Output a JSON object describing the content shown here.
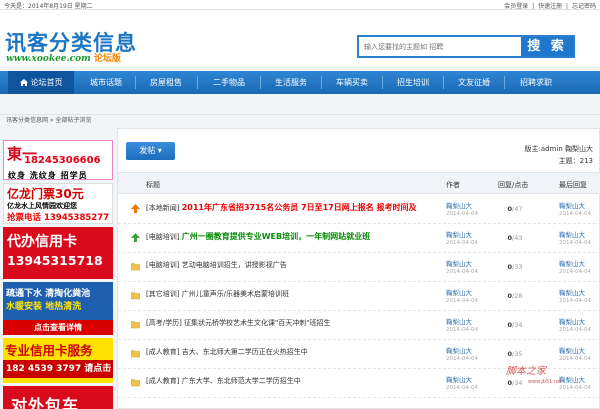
{
  "topbar": {
    "date": "今天是：2014年8月19日 星期二",
    "links": [
      "会员登录",
      "|",
      "快速注册",
      "|",
      "忘记密码"
    ]
  },
  "header": {
    "logo_main": "讯客分类信息",
    "logo_url": "www.xookee.com",
    "logo_badge": "论坛版",
    "search_placeholder": "输入您要找的主题如 招聘",
    "search_button": "搜 索"
  },
  "nav": {
    "items": [
      {
        "label": "论坛首页",
        "active": true
      },
      {
        "label": "城市话题"
      },
      {
        "label": "房屋租售"
      },
      {
        "label": "二手物品"
      },
      {
        "label": "生活服务"
      },
      {
        "label": "车辆买卖"
      },
      {
        "label": "招生培训"
      },
      {
        "label": "文友征婚"
      },
      {
        "label": "招聘求职"
      }
    ]
  },
  "breadcrumb": "讯客分类信息网 » 全部帖子浏览",
  "ads": {
    "ad1": {
      "big": "東一",
      "phone": "18245306606",
      "sub": "纹身 洗纹身 招学员"
    },
    "ad2": {
      "l1": "亿龙门票30元",
      "l2": "亿龙水上风情园欢迎您",
      "l3": "抢票电话 13945385277"
    },
    "ad3": {
      "l1": "代办信用卡",
      "l2": "13945315718"
    },
    "ad4": {
      "l1": "疏通下水 清掏化粪池",
      "l2": "水暖安装 地热清洗",
      "l3": "点击查看详情"
    },
    "ad5": {
      "l1": "专业信用卡服务",
      "l2": "182 4539 3797 请点击"
    },
    "ad6": {
      "l1": "对外包车"
    }
  },
  "main": {
    "post_button": "发帖",
    "moderator": "版主:admin 鞠梨山大",
    "topic_count": "主题：213",
    "headers": {
      "title": "标题",
      "author": "作者",
      "reply": "回复/点击",
      "last": "最后回复"
    },
    "rows": [
      {
        "icon": "hot",
        "tag": "[本地新闻]",
        "title": "2011年广东省招3715名公务员 7日至17日网上报名 报考时间及",
        "style": "hot",
        "author": "鞠梨山大",
        "date": "2014-04-04",
        "replies": "0",
        "clicks": "/47",
        "last_author": "鞠梨山大",
        "last_date": "2014-04-04"
      },
      {
        "icon": "hot",
        "tag": "[电脑培训]",
        "title": "广州一圈教育提供专业WEB培训，一年制网站就业班",
        "style": "green",
        "author": "鞠梨山大",
        "date": "2014-04-04",
        "replies": "0",
        "clicks": "/43",
        "last_author": "鞠梨山大",
        "last_date": "2014-04-04"
      },
      {
        "icon": "folder",
        "tag": "[电脑培训]",
        "title": "艺动电脑培训招生，讲授影视广告",
        "style": "normal",
        "author": "鞠梨山大",
        "date": "2014-04-04",
        "replies": "0",
        "clicks": "/33",
        "last_author": "鞠梨山大",
        "last_date": "2014-04-04"
      },
      {
        "icon": "folder",
        "tag": "[其它培训]",
        "title": "广州儿童声乐/乐器美术启蒙培训班",
        "style": "normal",
        "author": "鞠梨山大",
        "date": "2014-04-04",
        "replies": "0",
        "clicks": "/28",
        "last_author": "鞠梨山大",
        "last_date": "2014-04-04"
      },
      {
        "icon": "folder",
        "tag": "[高考/学历]",
        "title": "征集状元桥学校艺术生文化课\"百天冲刺\"班招生",
        "style": "normal",
        "author": "鞠梨山大",
        "date": "2014-04-04",
        "replies": "0",
        "clicks": "/34",
        "last_author": "鞠梨山大",
        "last_date": "2014-04-04"
      },
      {
        "icon": "folder",
        "tag": "[成人教育]",
        "title": "吉大、东北师大第二学历正在火热招生中",
        "style": "normal",
        "author": "鞠梨山大",
        "date": "2014-04-04",
        "replies": "0",
        "clicks": "/35",
        "last_author": "鞠梨山大",
        "last_date": "2014-04-04"
      },
      {
        "icon": "folder",
        "tag": "[成人教育]",
        "title": "广东大学、东北师范大学二学历招生中",
        "style": "normal",
        "author": "鞠梨山大",
        "date": "2014-04-04",
        "replies": "0",
        "clicks": "/34",
        "last_author": "鞠梨山大",
        "last_date": "2014-04-04"
      }
    ]
  },
  "watermark": {
    "text": "脚本之家",
    "url": "www.jb51.net"
  }
}
